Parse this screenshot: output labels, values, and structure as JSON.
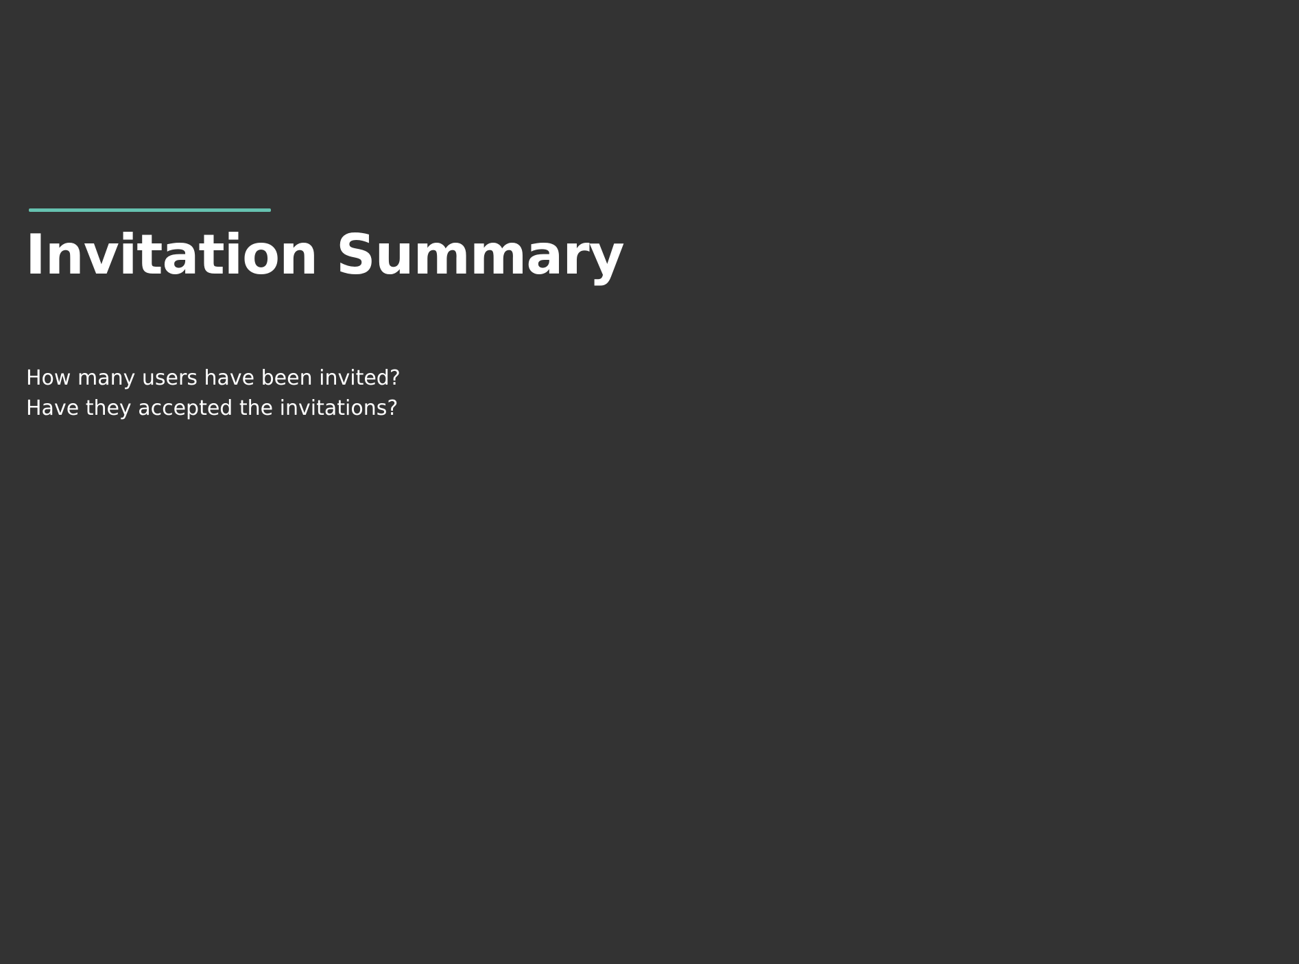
{
  "slide": {
    "title": "Invitation Summary",
    "subtitle_lines": [
      "How many users have been invited?",
      "Have they accepted the invitations?"
    ]
  },
  "colors": {
    "background": "#333333",
    "text": "#ffffff",
    "accent": "#66c2b0"
  }
}
